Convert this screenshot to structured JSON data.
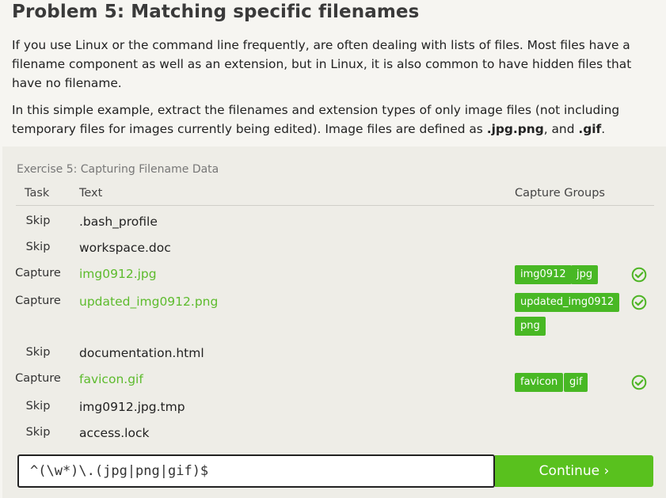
{
  "problem": {
    "title": "Problem 5: Matching specific filenames",
    "para1": "If you use Linux or the command line frequently, are often dealing with lists of files. Most files have a filename component as well as an extension, but in Linux, it is also common to have hidden files that have no filename.",
    "para2_text": "In this simple example, extract the filenames and extension types of only image files (not including temporary files for images currently being edited). Image files are defined as ",
    "para2_ext1": ".jpg",
    "para2_ext2": ".png",
    "para2_and": ", and ",
    "para2_ext3": ".gif",
    "para2_end": "."
  },
  "exercise": {
    "title": "Exercise 5: Capturing Filename Data",
    "headers": {
      "task": "Task",
      "text": "Text",
      "groups": "Capture Groups"
    },
    "rows": [
      {
        "task": "Skip",
        "text": ".bash_profile",
        "groups": []
      },
      {
        "task": "Skip",
        "text": "workspace.doc",
        "groups": []
      },
      {
        "task": "Capture",
        "text": "img0912.jpg",
        "groups": [
          "img0912",
          "jpg"
        ],
        "ok": true
      },
      {
        "task": "Capture",
        "text": "updated_img0912.png",
        "groups": [
          "updated_img0912",
          "png"
        ],
        "ok": true
      },
      {
        "task": "Skip",
        "text": "documentation.html",
        "groups": []
      },
      {
        "task": "Capture",
        "text": "favicon.gif",
        "groups": [
          "favicon",
          "gif"
        ],
        "ok": true
      },
      {
        "task": "Skip",
        "text": "img0912.jpg.tmp",
        "groups": []
      },
      {
        "task": "Skip",
        "text": "access.lock",
        "groups": []
      }
    ],
    "input_value": "^(\\w*)\\.(jpg|png|gif)$",
    "continue_label": "Continue ›"
  },
  "colors": {
    "accent": "#59c11e",
    "chip": "#48b824",
    "capture_text": "#5dbb2d",
    "check": "#4fb526"
  },
  "icons": {
    "success": "check-circle-icon"
  }
}
